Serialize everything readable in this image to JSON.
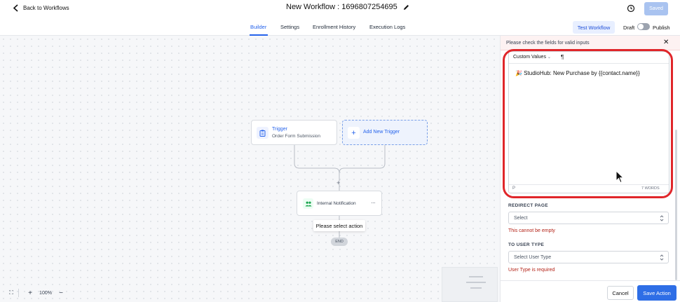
{
  "header": {
    "back_label": "Back to Workflows",
    "title": "New Workflow : 1696807254695",
    "saved_label": "Saved"
  },
  "tabs": [
    {
      "label": "Builder",
      "active": true
    },
    {
      "label": "Settings",
      "active": false
    },
    {
      "label": "Enrollment History",
      "active": false
    },
    {
      "label": "Execution Logs",
      "active": false
    }
  ],
  "toolbar": {
    "test_workflow_label": "Test Workflow",
    "draft_label": "Draft",
    "publish_label": "Publish"
  },
  "canvas": {
    "trigger": {
      "title": "Trigger",
      "subtitle": "Order Form Submission"
    },
    "add_trigger_label": "Add New Trigger",
    "add_step_symbol": "+",
    "action": {
      "label": "Internal Notification",
      "more": "···"
    },
    "tooltip": "Please select action",
    "end_label": "END",
    "zoom": {
      "fit_symbol": "⛶",
      "plus": "+",
      "level": "100%",
      "minus": "−"
    }
  },
  "panel": {
    "alert_message": "Please check the fields for valid inputs",
    "close_symbol": "✕",
    "editor": {
      "custom_values_label": "Custom Values",
      "paragraph_symbol": "¶",
      "content": "🎉 StudioHub: New Purchase by {{contact.name}}",
      "footer_tag": "P",
      "word_count": "7 WORDS"
    },
    "redirect_page": {
      "label": "REDIRECT PAGE",
      "placeholder": "Select",
      "error": "This cannot be empty"
    },
    "to_user_type": {
      "label": "TO USER TYPE",
      "placeholder": "Select User Type",
      "error": "User Type is required"
    },
    "cancel_label": "Cancel",
    "save_action_label": "Save Action"
  },
  "colors": {
    "accent": "#2e6ee6",
    "error": "#b42318",
    "highlight_circle": "#e0262a"
  }
}
